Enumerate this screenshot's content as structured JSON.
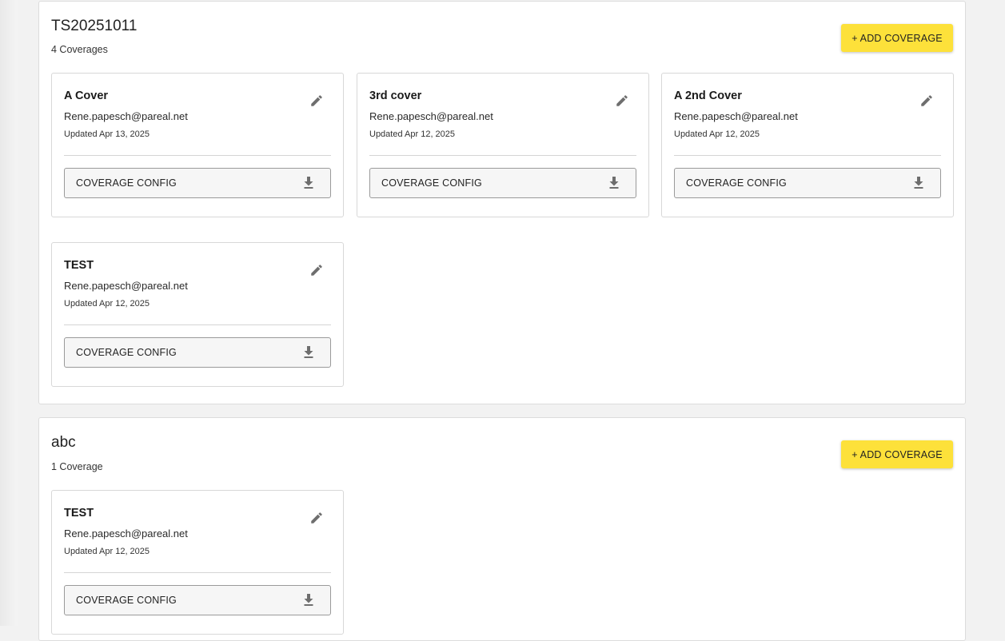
{
  "colors": {
    "accent": "#fde13a",
    "card_border": "#d8d8d8",
    "icon": "#6e6e6e"
  },
  "groups": [
    {
      "title": "TS20251011",
      "count": "4 Coverages",
      "add_label": "+ ADD COVERAGE",
      "cards": [
        {
          "title": "A Cover",
          "email": "Rene.papesch@pareal.net",
          "updated": "Updated Apr 13, 2025",
          "button": "COVERAGE CONFIG",
          "edit_icon": "pencil-icon",
          "download_icon": "download-icon"
        },
        {
          "title": "3rd cover",
          "email": "Rene.papesch@pareal.net",
          "updated": "Updated Apr 12, 2025",
          "button": "COVERAGE CONFIG",
          "edit_icon": "pencil-icon",
          "download_icon": "download-icon"
        },
        {
          "title": "A 2nd Cover",
          "email": "Rene.papesch@pareal.net",
          "updated": "Updated Apr 12, 2025",
          "button": "COVERAGE CONFIG",
          "edit_icon": "pencil-icon",
          "download_icon": "download-icon"
        },
        {
          "title": "TEST",
          "email": "Rene.papesch@pareal.net",
          "updated": "Updated Apr 12, 2025",
          "button": "COVERAGE CONFIG",
          "edit_icon": "pencil-icon",
          "download_icon": "download-icon"
        }
      ]
    },
    {
      "title": "abc",
      "count": "1 Coverage",
      "add_label": "+ ADD COVERAGE",
      "cards": [
        {
          "title": "TEST",
          "email": "Rene.papesch@pareal.net",
          "updated": "Updated Apr 12, 2025",
          "button": "COVERAGE CONFIG",
          "edit_icon": "pencil-icon",
          "download_icon": "download-icon"
        }
      ]
    }
  ]
}
